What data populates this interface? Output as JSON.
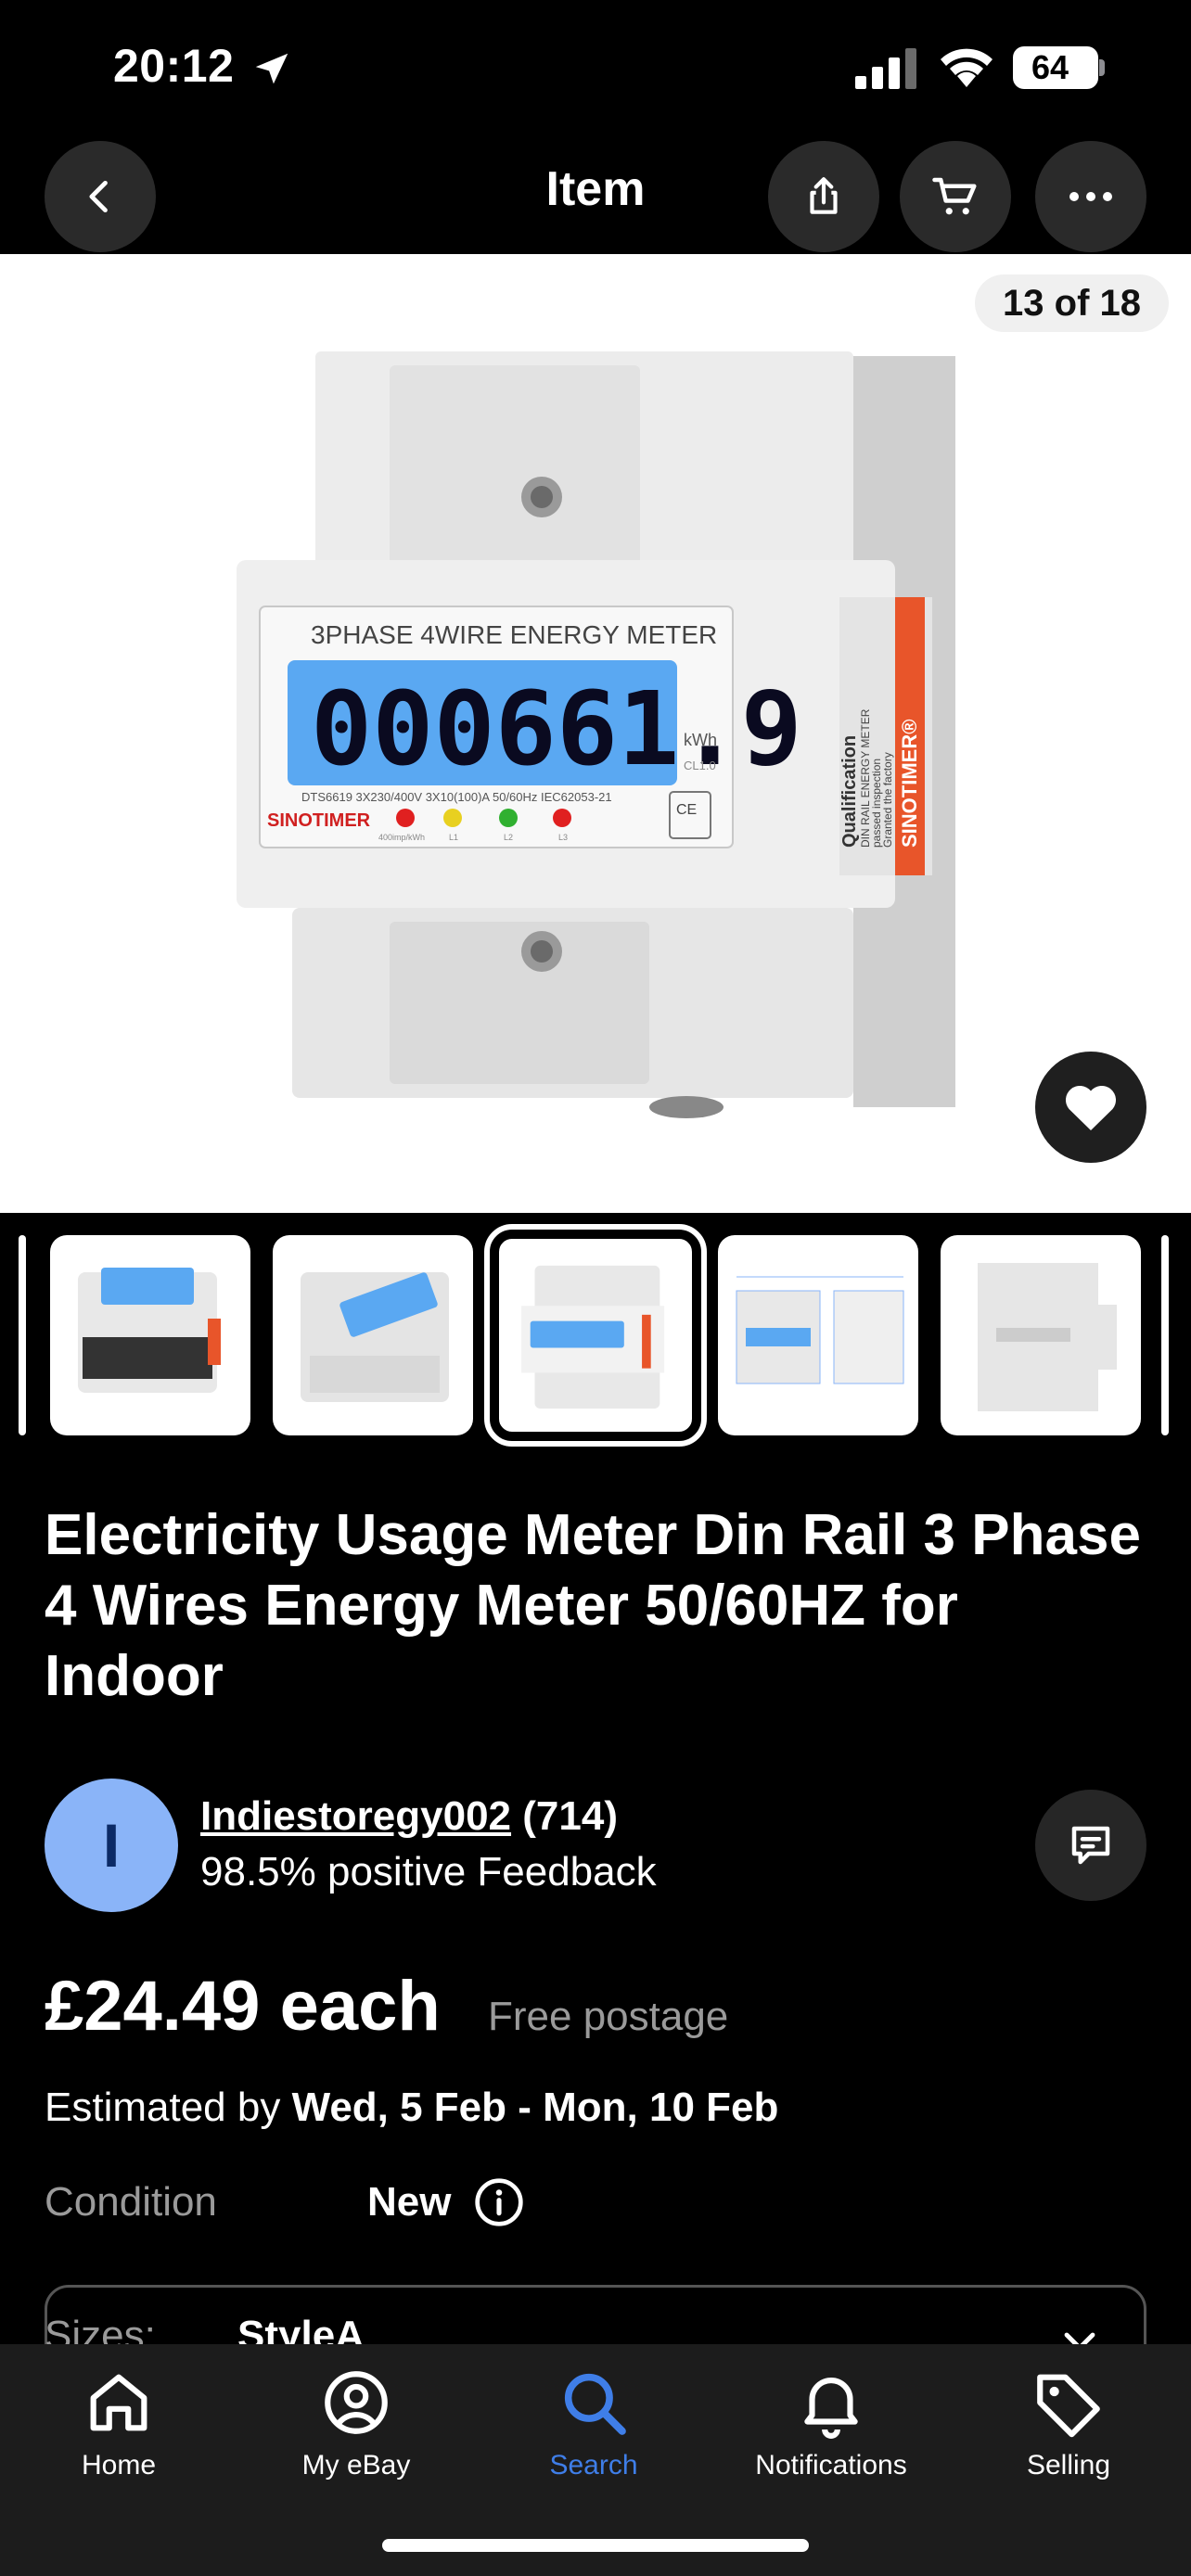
{
  "status_bar": {
    "time": "20:12",
    "battery": "64"
  },
  "navbar": {
    "title": "Item"
  },
  "hero": {
    "image_counter": "13 of 18",
    "product_image": {
      "meter_label": "3PHASE 4WIRE ENERGY METER",
      "lcd_reading": "000661.9",
      "unit": "kWh",
      "class": "CL1.0",
      "spec_line": "DTS6619  3X230/400V  3X10(100)A  50/60Hz  IEC62053-21",
      "brand": "SINOTIMER",
      "side_label": "Qualification",
      "side_text_1": "DIN RAIL ENERGY METER",
      "side_text_2": "passed inspection",
      "side_text_3": "Granted the factory",
      "side_brand": "SINOTIMER®",
      "impulse": "400imp/kWh",
      "leds": [
        "L1",
        "L2",
        "L3"
      ]
    }
  },
  "product": {
    "title": "Electricity Usage Meter Din Rail 3 Phase 4 Wires Energy Meter 50/60HZ for Indoor"
  },
  "seller": {
    "avatar_letter": "I",
    "name": "Indiestoregy002",
    "ratings": "(714)",
    "feedback": "98.5% positive Feedback"
  },
  "price": {
    "amount": "£24.49 each",
    "postage": "Free postage",
    "estimated_label": "Estimated by",
    "estimated_dates": "Wed, 5 Feb - Mon, 10 Feb"
  },
  "condition": {
    "label": "Condition",
    "value": "New"
  },
  "sizes": {
    "label": "Sizes:",
    "value": "StyleA"
  },
  "tabbar": {
    "home": "Home",
    "my_ebay": "My eBay",
    "search": "Search",
    "notifications": "Notifications",
    "selling": "Selling"
  },
  "colors": {
    "accent_blue": "#3f7ee8",
    "avatar_bg": "#8ab4f8",
    "lcd_blue": "#5aa8f2",
    "label_orange": "#e8552a"
  }
}
